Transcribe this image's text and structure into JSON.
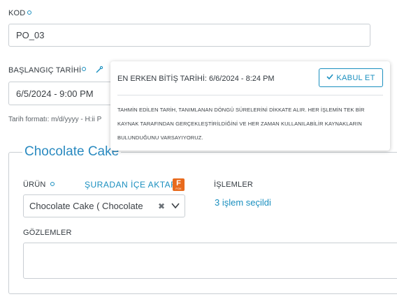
{
  "kod": {
    "label": "KOD",
    "value": "PO_03"
  },
  "start_date": {
    "label": "BAŞLANGIÇ TARİHİ",
    "value": "6/5/2024 - 9:00 PM",
    "format_hint": "Tarih formatı: m/d/yyyy - H:ii P"
  },
  "product_section": {
    "legend": "Chocolate Cake",
    "product_label": "ÜRÜN",
    "import_link": "ŞURADAN İÇE AKTAR",
    "product_value": "Chocolate Cake ( Chocolate",
    "clear_glyph": "✖",
    "operations_label": "İŞLEMLER",
    "operations_link": "3 işlem seçildi",
    "observations_label": "GÖZLEMLER",
    "observations_value": ""
  },
  "popover": {
    "title": "EN ERKEN BİTİŞ TARİHİ: 6/6/2024 - 8:24 PM",
    "accept_label": "KABUL ET",
    "body": "TAHMİN EDİLEN TARİH, TANIMLANAN DÖNGÜ SÜRELERİNİ DİKKATE ALIR. HER İŞLEMİN TEK BİR KAYNAK TARAFINDAN GERÇEKLEŞTİRİLDİĞİNİ VE HER ZAMAN KULLANILABİLİR KAYNAKLARIN BULUNDUĞUNU VARSAYIYORUZ."
  },
  "icons": {
    "required": "required-dot-icon",
    "estimate": "wand-icon",
    "checkmark": "check-icon",
    "chevron": "chevron-down-icon",
    "import_badge": "app-f-icon"
  },
  "colors": {
    "accent": "#1a8fbf",
    "badge": "#e86a1c",
    "border": "#c9ced3"
  }
}
